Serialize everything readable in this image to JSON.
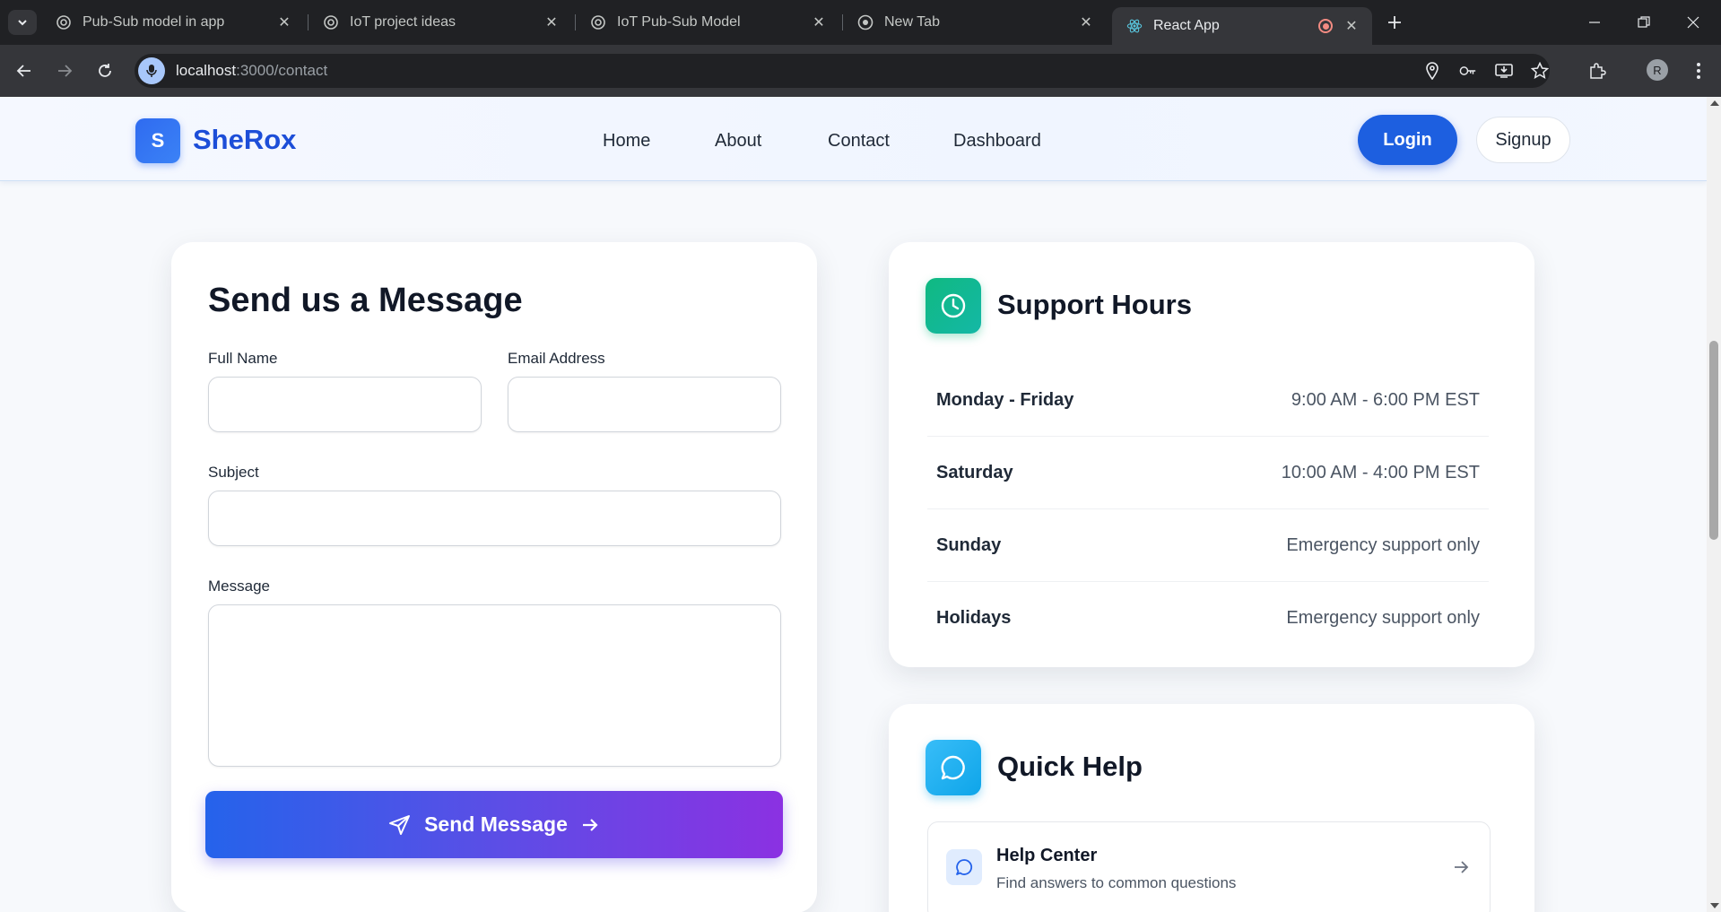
{
  "browser": {
    "tabs": [
      {
        "title": "Pub-Sub model in app",
        "favicon": "chatgpt-icon"
      },
      {
        "title": "IoT project ideas",
        "favicon": "chatgpt-icon"
      },
      {
        "title": "IoT Pub-Sub Model",
        "favicon": "chatgpt-icon"
      },
      {
        "title": "New Tab",
        "favicon": "chrome-icon"
      },
      {
        "title": "React App",
        "favicon": "react-icon",
        "active": true
      }
    ],
    "url_host": "localhost",
    "url_path": ":3000/contact",
    "profile_initial": "R"
  },
  "site": {
    "logo_letter": "S",
    "brand": "SheRox",
    "nav": [
      "Home",
      "About",
      "Contact",
      "Dashboard"
    ],
    "login_label": "Login",
    "signup_label": "Signup"
  },
  "form": {
    "title": "Send us a Message",
    "full_name_label": "Full Name",
    "email_label": "Email Address",
    "subject_label": "Subject",
    "message_label": "Message",
    "full_name_value": "",
    "email_value": "",
    "subject_value": "",
    "message_value": "",
    "submit_label": "Send Message"
  },
  "support": {
    "title": "Support Hours",
    "rows": [
      {
        "day": "Monday - Friday",
        "time": "9:00 AM - 6:00 PM EST"
      },
      {
        "day": "Saturday",
        "time": "10:00 AM - 4:00 PM EST"
      },
      {
        "day": "Sunday",
        "time": "Emergency support only"
      },
      {
        "day": "Holidays",
        "time": "Emergency support only"
      }
    ]
  },
  "quick_help": {
    "title": "Quick Help",
    "items": [
      {
        "title": "Help Center",
        "subtitle": "Find answers to common questions"
      }
    ]
  },
  "colors": {
    "primary": "#1d5fe0",
    "brand_text": "#1d4ed8",
    "support_icon": "#10b981",
    "help_icon": "#0ea5e9",
    "send_gradient_start": "#2563eb",
    "send_gradient_end": "#8b31e2"
  }
}
